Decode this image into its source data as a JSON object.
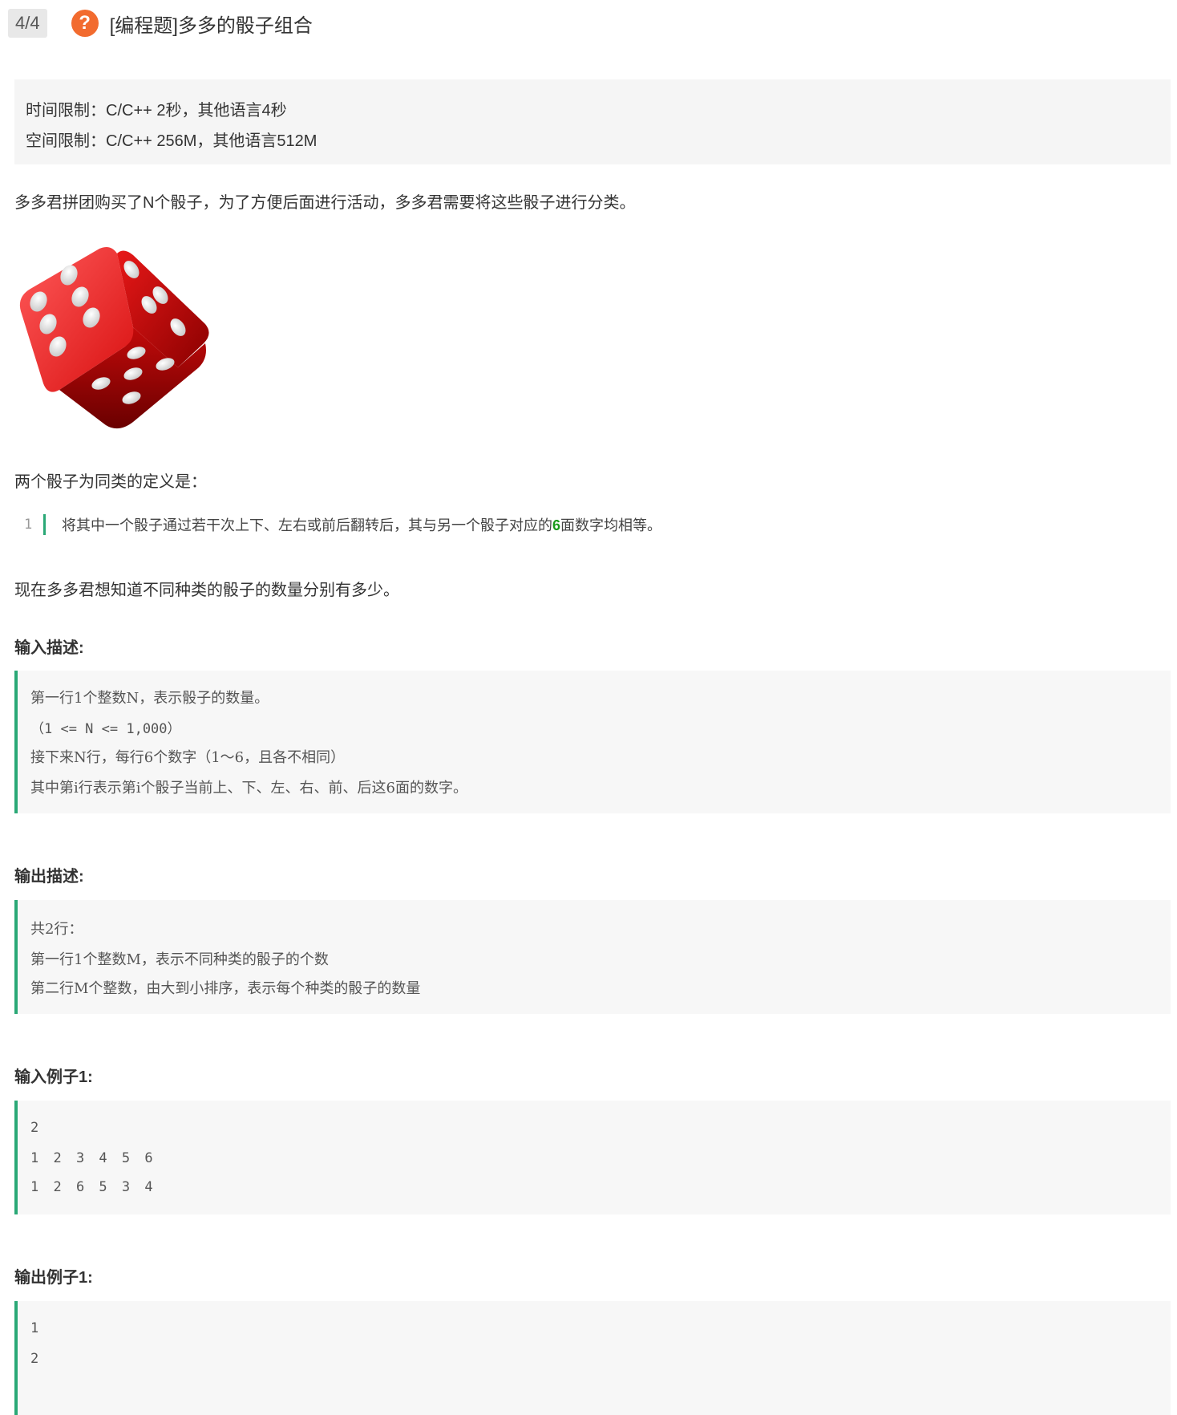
{
  "header": {
    "progress": "4/4",
    "title": "[编程题]多多的骰子组合"
  },
  "limits": {
    "time": "时间限制：C/C++ 2秒，其他语言4秒",
    "space": "空间限制：C/C++ 256M，其他语言512M"
  },
  "intro": "多多君拼团购买了N个骰子，为了方便后面进行活动，多多君需要将这些骰子进行分类。",
  "definition_heading": "两个骰子为同类的定义是：",
  "definition_code": {
    "line_number": "1",
    "text_before": "将其中一个骰子通过若干次上下、左右或前后翻转后，其与另一个骰子对应的",
    "highlight": "6",
    "text_after": "面数字均相等。"
  },
  "question": "现在多多君想知道不同种类的骰子的数量分别有多少。",
  "input_desc": {
    "heading": "输入描述:",
    "lines": [
      "第一行1个整数N，表示骰子的数量。",
      "（1 <= N <= 1,000）",
      "接下来N行，每行6个数字（1～6，且各不相同）",
      "其中第i行表示第i个骰子当前上、下、左、右、前、后这6面的数字。"
    ]
  },
  "output_desc": {
    "heading": "输出描述:",
    "lines": [
      "共2行：",
      "第一行1个整数M，表示不同种类的骰子的个数",
      "第二行M个整数，由大到小排序，表示每个种类的骰子的数量"
    ]
  },
  "input_example": {
    "heading": "输入例子1:",
    "lines": [
      "2",
      "1 2 3 4 5 6",
      "1 2 6 5 3 4"
    ]
  },
  "output_example": {
    "heading": "输出例子1:",
    "lines": [
      "1",
      "2"
    ]
  },
  "colors": {
    "accent_bar": "#2aa876",
    "question_icon": "#f26b2f",
    "dice": "#e01818"
  }
}
